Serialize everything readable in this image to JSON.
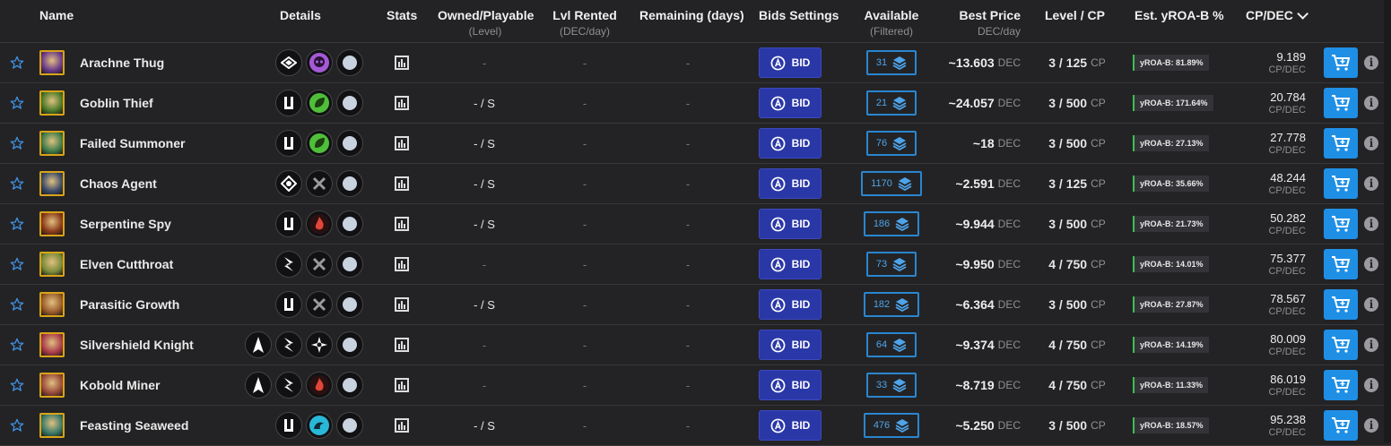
{
  "headers": {
    "name": "Name",
    "details": "Details",
    "stats": "Stats",
    "owned": "Owned/Playable",
    "owned_sub": "(Level)",
    "lvl_rented": "Lvl Rented",
    "lvl_rented_sub": "(DEC/day)",
    "remaining": "Remaining (days)",
    "bids": "Bids Settings",
    "available": "Available",
    "available_sub": "(Filtered)",
    "best_price": "Best Price",
    "best_price_sub": "DEC/day",
    "level_cp": "Level / CP",
    "yroa": "Est. yROA-B %",
    "cp_dec": "CP/DEC"
  },
  "labels": {
    "bid": "BID",
    "cp_unit": "CP",
    "dec_unit": "DEC",
    "cpdec_unit": "CP/DEC"
  },
  "colors": {
    "accent": "#2a37a7",
    "cart": "#1f8fe6",
    "avail": "#2a86d0",
    "yroa_bar": "#3fbf4f",
    "frame": "#d9a418"
  },
  "rows": [
    {
      "name": "Arachne Thug",
      "icons": [
        "melee-diamond-icon",
        "death-skull-icon",
        "neutral-dot-icon"
      ],
      "owned": "-",
      "lvl_rented": "-",
      "remaining": "-",
      "available": "31",
      "best_price": "~13.603",
      "level": "3 / 125",
      "yroa": "yROA-B: 81.89%",
      "cp_dec": "9.189",
      "av": "#6b3a8a"
    },
    {
      "name": "Goblin Thief",
      "icons": [
        "sneak-bars-icon",
        "earth-leaf-icon",
        "neutral-dot-icon"
      ],
      "owned": "- / S",
      "lvl_rented": "-",
      "remaining": "-",
      "available": "21",
      "best_price": "~24.057",
      "level": "3 / 500",
      "yroa": "yROA-B: 171.64%",
      "cp_dec": "20.784",
      "av": "#4b7a2a"
    },
    {
      "name": "Failed Summoner",
      "icons": [
        "sneak-bars-icon",
        "earth-leaf-icon",
        "neutral-dot-icon"
      ],
      "owned": "- / S",
      "lvl_rented": "-",
      "remaining": "-",
      "available": "76",
      "best_price": "~18",
      "level": "3 / 500",
      "yroa": "yROA-B: 27.13%",
      "cp_dec": "27.778",
      "av": "#3f7c4a"
    },
    {
      "name": "Chaos Agent",
      "icons": [
        "retaliate-diamond-icon",
        "neutral-swords-icon",
        "neutral-dot-icon"
      ],
      "owned": "- / S",
      "lvl_rented": "-",
      "remaining": "-",
      "available": "1170",
      "best_price": "~2.591",
      "level": "3 / 125",
      "yroa": "yROA-B: 35.66%",
      "cp_dec": "48.244",
      "av": "#3a4a6a"
    },
    {
      "name": "Serpentine Spy",
      "icons": [
        "sneak-bars-icon",
        "fire-flame-icon",
        "neutral-dot-icon"
      ],
      "owned": "- / S",
      "lvl_rented": "-",
      "remaining": "-",
      "available": "186",
      "best_price": "~9.944",
      "level": "3 / 500",
      "yroa": "yROA-B: 21.73%",
      "cp_dec": "50.282",
      "av": "#8a3a1a"
    },
    {
      "name": "Elven Cutthroat",
      "icons": [
        "speed-bolt-icon",
        "neutral-swords-icon",
        "neutral-dot-icon"
      ],
      "owned": "-",
      "lvl_rented": "-",
      "remaining": "-",
      "available": "73",
      "best_price": "~9.950",
      "level": "4 / 750",
      "yroa": "yROA-B: 14.01%",
      "cp_dec": "75.377",
      "av": "#7a8a3a"
    },
    {
      "name": "Parasitic Growth",
      "icons": [
        "sneak-bars-icon",
        "neutral-swords-icon",
        "neutral-dot-icon"
      ],
      "owned": "- / S",
      "lvl_rented": "-",
      "remaining": "-",
      "available": "182",
      "best_price": "~6.364",
      "level": "3 / 500",
      "yroa": "yROA-B: 27.87%",
      "cp_dec": "78.567",
      "av": "#9a5a2a"
    },
    {
      "name": "Silvershield Knight",
      "icons": [
        "triumph-arrow-icon",
        "speed-bolt-icon",
        "life-compass-icon",
        "neutral-dot-icon"
      ],
      "owned": "-",
      "lvl_rented": "-",
      "remaining": "-",
      "available": "64",
      "best_price": "~9.374",
      "level": "4 / 750",
      "yroa": "yROA-B: 14.19%",
      "cp_dec": "80.009",
      "av": "#aa3a4a"
    },
    {
      "name": "Kobold Miner",
      "icons": [
        "triumph-arrow-icon",
        "speed-bolt-icon",
        "fire-flame-icon",
        "neutral-dot-icon"
      ],
      "owned": "-",
      "lvl_rented": "-",
      "remaining": "-",
      "available": "33",
      "best_price": "~8.719",
      "level": "4 / 750",
      "yroa": "yROA-B: 11.33%",
      "cp_dec": "86.019",
      "av": "#9a4a3a"
    },
    {
      "name": "Feasting Seaweed",
      "icons": [
        "sneak-bars-icon",
        "water-wave-icon",
        "neutral-dot-icon"
      ],
      "owned": "- / S",
      "lvl_rented": "-",
      "remaining": "-",
      "available": "476",
      "best_price": "~5.250",
      "level": "3 / 500",
      "yroa": "yROA-B: 18.57%",
      "cp_dec": "95.238",
      "av": "#3a7a6a"
    }
  ]
}
